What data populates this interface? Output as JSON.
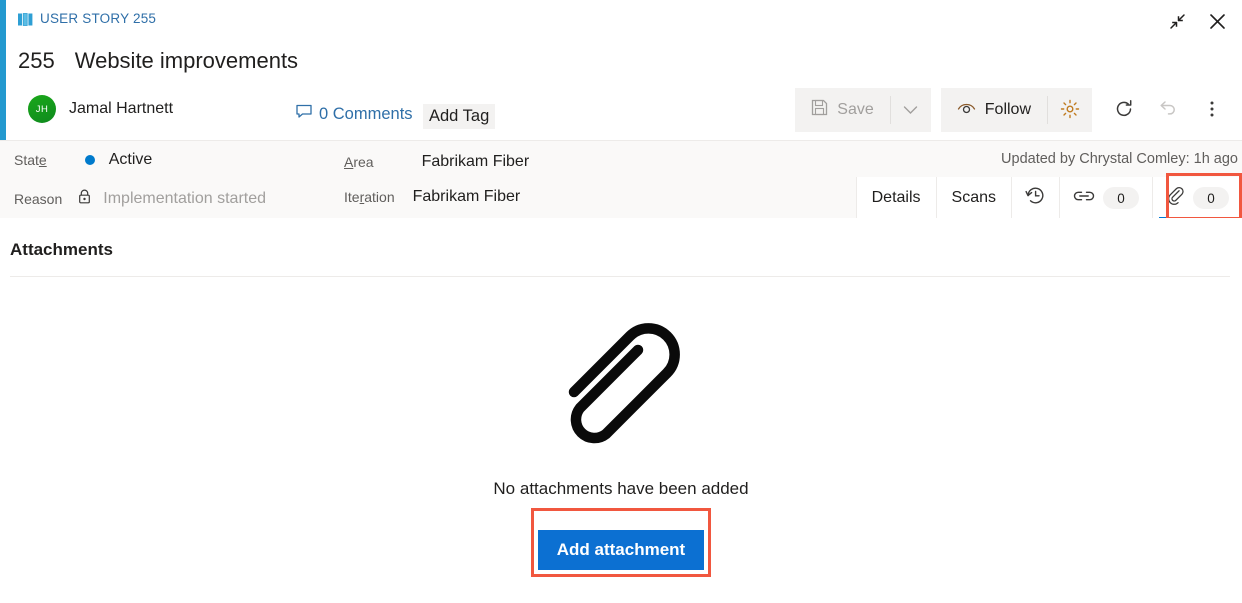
{
  "header": {
    "breadcrumb": "USER STORY 255",
    "breadcrumb_icon": "story-book-icon",
    "work_item_id": "255",
    "work_item_title": "Website improvements",
    "author": {
      "initials": "JH",
      "name": "Jamal Hartnett",
      "avatar_color": "#13a10e"
    },
    "comments_label": "0 Comments",
    "add_tag_label": "Add Tag",
    "accent_color": "#2399cf"
  },
  "window_controls": {
    "restore_label": "Restore",
    "close_label": "Close"
  },
  "toolbar": {
    "save_label": "Save",
    "save_enabled": false,
    "save_caret_label": "Save options",
    "follow_label": "Follow",
    "settings_label": "Settings",
    "refresh_label": "Refresh",
    "undo_label": "Undo",
    "more_label": "More actions"
  },
  "fields": [
    {
      "label_pre": "Stat",
      "label_key": "e",
      "label_post": "",
      "value": "Active",
      "type": "state",
      "dot_color": "#007acc",
      "muted": false
    },
    {
      "label_pre": "Reason",
      "label_key": "",
      "label_post": "",
      "value": "Implementation started",
      "type": "locked",
      "muted": true
    },
    {
      "label_pre": "",
      "label_key": "A",
      "label_post": "rea",
      "value": "Fabrikam Fiber",
      "type": "plain",
      "muted": false
    },
    {
      "label_pre": "Ite",
      "label_key": "r",
      "label_post": "ation",
      "value": "Fabrikam Fiber",
      "type": "plain",
      "muted": false
    }
  ],
  "updated_by": "Updated by Chrystal Comley: 1h ago",
  "tabs": [
    {
      "label": "Details",
      "icon": null,
      "count": null,
      "selected": false
    },
    {
      "label": "Scans",
      "icon": null,
      "count": null,
      "selected": false
    },
    {
      "label": "",
      "icon": "history-clock-icon",
      "count": null,
      "selected": false
    },
    {
      "label": "",
      "icon": "link-chain-icon",
      "count": "0",
      "selected": false
    },
    {
      "label": "",
      "icon": "paperclip-icon",
      "count": "0",
      "selected": true
    }
  ],
  "tooltip": {
    "text": "Attachments"
  },
  "content": {
    "section_title": "Attachments",
    "empty_icon": "large-paperclip-icon",
    "empty_text": "No attachments have been added",
    "add_attachment_label": "Add attachment",
    "add_attachment_color": "#0c70d2"
  },
  "annotations": {
    "highlight_color": "#f1573f"
  }
}
